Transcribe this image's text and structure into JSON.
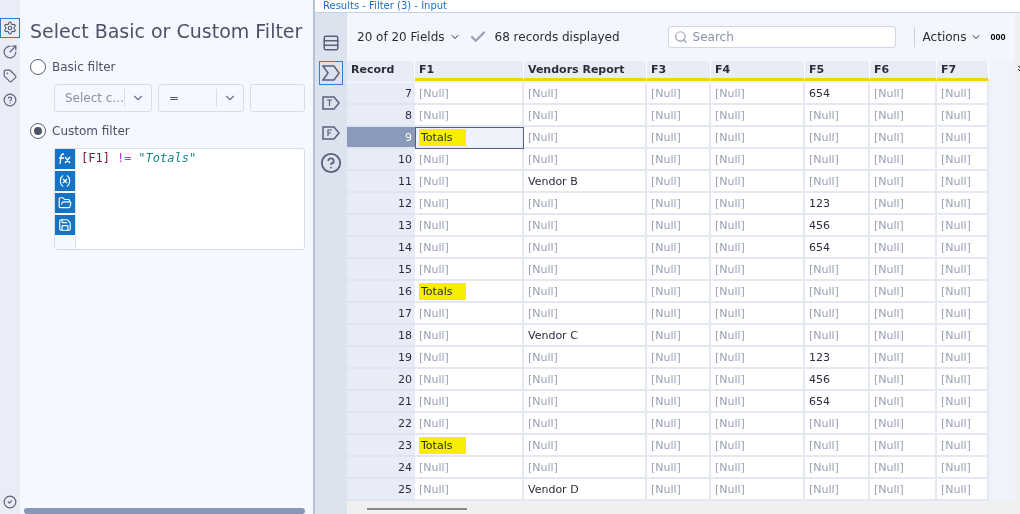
{
  "results_header": {
    "title": "Results - Filter (3) - Input"
  },
  "config": {
    "title": "Select Basic or Custom Filter",
    "options": [
      {
        "label": "Basic filter",
        "selected": false
      },
      {
        "label": "Custom filter",
        "selected": true
      }
    ],
    "basic": {
      "column_placeholder": "Select c...",
      "operator": "="
    },
    "expression": [
      {
        "kind": "field",
        "text": "[F1]"
      },
      {
        "kind": "operator",
        "text": "!="
      },
      {
        "kind": "string",
        "text": "\"Totals\""
      }
    ]
  },
  "toolbar": {
    "fields": "20 of 20 Fields",
    "records": "68 records displayed",
    "search_placeholder": "Search",
    "actions": "Actions",
    "more": "000"
  },
  "table": {
    "columns": [
      "Record",
      "F1",
      "Vendors Report",
      "F3",
      "F4",
      "F5",
      "F6",
      "F7"
    ],
    "rows": [
      {
        "selected": false,
        "cells": [
          {
            "text": "7"
          },
          {
            "text": "[Null]",
            "null": true
          },
          {
            "text": "[Null]",
            "null": true
          },
          {
            "text": "[Null]",
            "null": true
          },
          {
            "text": "[Null]",
            "null": true
          },
          {
            "text": "654",
            "null": false
          },
          {
            "text": "[Null]",
            "null": true
          },
          {
            "text": "[Null]",
            "null": true
          }
        ]
      },
      {
        "selected": false,
        "cells": [
          {
            "text": "8"
          },
          {
            "text": "[Null]",
            "null": true
          },
          {
            "text": "[Null]",
            "null": true
          },
          {
            "text": "[Null]",
            "null": true
          },
          {
            "text": "[Null]",
            "null": true
          },
          {
            "text": "[Null]",
            "null": true
          },
          {
            "text": "[Null]",
            "null": true
          },
          {
            "text": "[Null]",
            "null": true
          }
        ]
      },
      {
        "selected": true,
        "cells": [
          {
            "text": "9"
          },
          {
            "text": "Totals",
            "null": false,
            "highlight": true
          },
          {
            "text": "[Null]",
            "null": true
          },
          {
            "text": "[Null]",
            "null": true
          },
          {
            "text": "[Null]",
            "null": true
          },
          {
            "text": "[Null]",
            "null": true
          },
          {
            "text": "[Null]",
            "null": true
          },
          {
            "text": "[Null]",
            "null": true
          }
        ]
      },
      {
        "selected": false,
        "cells": [
          {
            "text": "10"
          },
          {
            "text": "[Null]",
            "null": true
          },
          {
            "text": "[Null]",
            "null": true
          },
          {
            "text": "[Null]",
            "null": true
          },
          {
            "text": "[Null]",
            "null": true
          },
          {
            "text": "[Null]",
            "null": true
          },
          {
            "text": "[Null]",
            "null": true
          },
          {
            "text": "[Null]",
            "null": true
          }
        ]
      },
      {
        "selected": false,
        "cells": [
          {
            "text": "11"
          },
          {
            "text": "[Null]",
            "null": true
          },
          {
            "text": "Vendor B",
            "null": false
          },
          {
            "text": "[Null]",
            "null": true
          },
          {
            "text": "[Null]",
            "null": true
          },
          {
            "text": "[Null]",
            "null": true
          },
          {
            "text": "[Null]",
            "null": true
          },
          {
            "text": "[Null]",
            "null": true
          }
        ]
      },
      {
        "selected": false,
        "cells": [
          {
            "text": "12"
          },
          {
            "text": "[Null]",
            "null": true
          },
          {
            "text": "[Null]",
            "null": true
          },
          {
            "text": "[Null]",
            "null": true
          },
          {
            "text": "[Null]",
            "null": true
          },
          {
            "text": "123",
            "null": false
          },
          {
            "text": "[Null]",
            "null": true
          },
          {
            "text": "[Null]",
            "null": true
          }
        ]
      },
      {
        "selected": false,
        "cells": [
          {
            "text": "13"
          },
          {
            "text": "[Null]",
            "null": true
          },
          {
            "text": "[Null]",
            "null": true
          },
          {
            "text": "[Null]",
            "null": true
          },
          {
            "text": "[Null]",
            "null": true
          },
          {
            "text": "456",
            "null": false
          },
          {
            "text": "[Null]",
            "null": true
          },
          {
            "text": "[Null]",
            "null": true
          }
        ]
      },
      {
        "selected": false,
        "cells": [
          {
            "text": "14"
          },
          {
            "text": "[Null]",
            "null": true
          },
          {
            "text": "[Null]",
            "null": true
          },
          {
            "text": "[Null]",
            "null": true
          },
          {
            "text": "[Null]",
            "null": true
          },
          {
            "text": "654",
            "null": false
          },
          {
            "text": "[Null]",
            "null": true
          },
          {
            "text": "[Null]",
            "null": true
          }
        ]
      },
      {
        "selected": false,
        "cells": [
          {
            "text": "15"
          },
          {
            "text": "[Null]",
            "null": true
          },
          {
            "text": "[Null]",
            "null": true
          },
          {
            "text": "[Null]",
            "null": true
          },
          {
            "text": "[Null]",
            "null": true
          },
          {
            "text": "[Null]",
            "null": true
          },
          {
            "text": "[Null]",
            "null": true
          },
          {
            "text": "[Null]",
            "null": true
          }
        ]
      },
      {
        "selected": false,
        "cells": [
          {
            "text": "16"
          },
          {
            "text": "Totals",
            "null": false,
            "highlight": true
          },
          {
            "text": "[Null]",
            "null": true
          },
          {
            "text": "[Null]",
            "null": true
          },
          {
            "text": "[Null]",
            "null": true
          },
          {
            "text": "[Null]",
            "null": true
          },
          {
            "text": "[Null]",
            "null": true
          },
          {
            "text": "[Null]",
            "null": true
          }
        ]
      },
      {
        "selected": false,
        "cells": [
          {
            "text": "17"
          },
          {
            "text": "[Null]",
            "null": true
          },
          {
            "text": "[Null]",
            "null": true
          },
          {
            "text": "[Null]",
            "null": true
          },
          {
            "text": "[Null]",
            "null": true
          },
          {
            "text": "[Null]",
            "null": true
          },
          {
            "text": "[Null]",
            "null": true
          },
          {
            "text": "[Null]",
            "null": true
          }
        ]
      },
      {
        "selected": false,
        "cells": [
          {
            "text": "18"
          },
          {
            "text": "[Null]",
            "null": true
          },
          {
            "text": "Vendor C",
            "null": false
          },
          {
            "text": "[Null]",
            "null": true
          },
          {
            "text": "[Null]",
            "null": true
          },
          {
            "text": "[Null]",
            "null": true
          },
          {
            "text": "[Null]",
            "null": true
          },
          {
            "text": "[Null]",
            "null": true
          }
        ]
      },
      {
        "selected": false,
        "cells": [
          {
            "text": "19"
          },
          {
            "text": "[Null]",
            "null": true
          },
          {
            "text": "[Null]",
            "null": true
          },
          {
            "text": "[Null]",
            "null": true
          },
          {
            "text": "[Null]",
            "null": true
          },
          {
            "text": "123",
            "null": false
          },
          {
            "text": "[Null]",
            "null": true
          },
          {
            "text": "[Null]",
            "null": true
          }
        ]
      },
      {
        "selected": false,
        "cells": [
          {
            "text": "20"
          },
          {
            "text": "[Null]",
            "null": true
          },
          {
            "text": "[Null]",
            "null": true
          },
          {
            "text": "[Null]",
            "null": true
          },
          {
            "text": "[Null]",
            "null": true
          },
          {
            "text": "456",
            "null": false
          },
          {
            "text": "[Null]",
            "null": true
          },
          {
            "text": "[Null]",
            "null": true
          }
        ]
      },
      {
        "selected": false,
        "cells": [
          {
            "text": "21"
          },
          {
            "text": "[Null]",
            "null": true
          },
          {
            "text": "[Null]",
            "null": true
          },
          {
            "text": "[Null]",
            "null": true
          },
          {
            "text": "[Null]",
            "null": true
          },
          {
            "text": "654",
            "null": false
          },
          {
            "text": "[Null]",
            "null": true
          },
          {
            "text": "[Null]",
            "null": true
          }
        ]
      },
      {
        "selected": false,
        "cells": [
          {
            "text": "22"
          },
          {
            "text": "[Null]",
            "null": true
          },
          {
            "text": "[Null]",
            "null": true
          },
          {
            "text": "[Null]",
            "null": true
          },
          {
            "text": "[Null]",
            "null": true
          },
          {
            "text": "[Null]",
            "null": true
          },
          {
            "text": "[Null]",
            "null": true
          },
          {
            "text": "[Null]",
            "null": true
          }
        ]
      },
      {
        "selected": false,
        "cells": [
          {
            "text": "23"
          },
          {
            "text": "Totals",
            "null": false,
            "highlight": true
          },
          {
            "text": "[Null]",
            "null": true
          },
          {
            "text": "[Null]",
            "null": true
          },
          {
            "text": "[Null]",
            "null": true
          },
          {
            "text": "[Null]",
            "null": true
          },
          {
            "text": "[Null]",
            "null": true
          },
          {
            "text": "[Null]",
            "null": true
          }
        ]
      },
      {
        "selected": false,
        "cells": [
          {
            "text": "24"
          },
          {
            "text": "[Null]",
            "null": true
          },
          {
            "text": "[Null]",
            "null": true
          },
          {
            "text": "[Null]",
            "null": true
          },
          {
            "text": "[Null]",
            "null": true
          },
          {
            "text": "[Null]",
            "null": true
          },
          {
            "text": "[Null]",
            "null": true
          },
          {
            "text": "[Null]",
            "null": true
          }
        ]
      },
      {
        "selected": false,
        "cells": [
          {
            "text": "25"
          },
          {
            "text": "[Null]",
            "null": true
          },
          {
            "text": "Vendor D",
            "null": false
          },
          {
            "text": "[Null]",
            "null": true
          },
          {
            "text": "[Null]",
            "null": true
          },
          {
            "text": "[Null]",
            "null": true
          },
          {
            "text": "[Null]",
            "null": true
          },
          {
            "text": "[Null]",
            "null": true
          }
        ]
      }
    ]
  }
}
